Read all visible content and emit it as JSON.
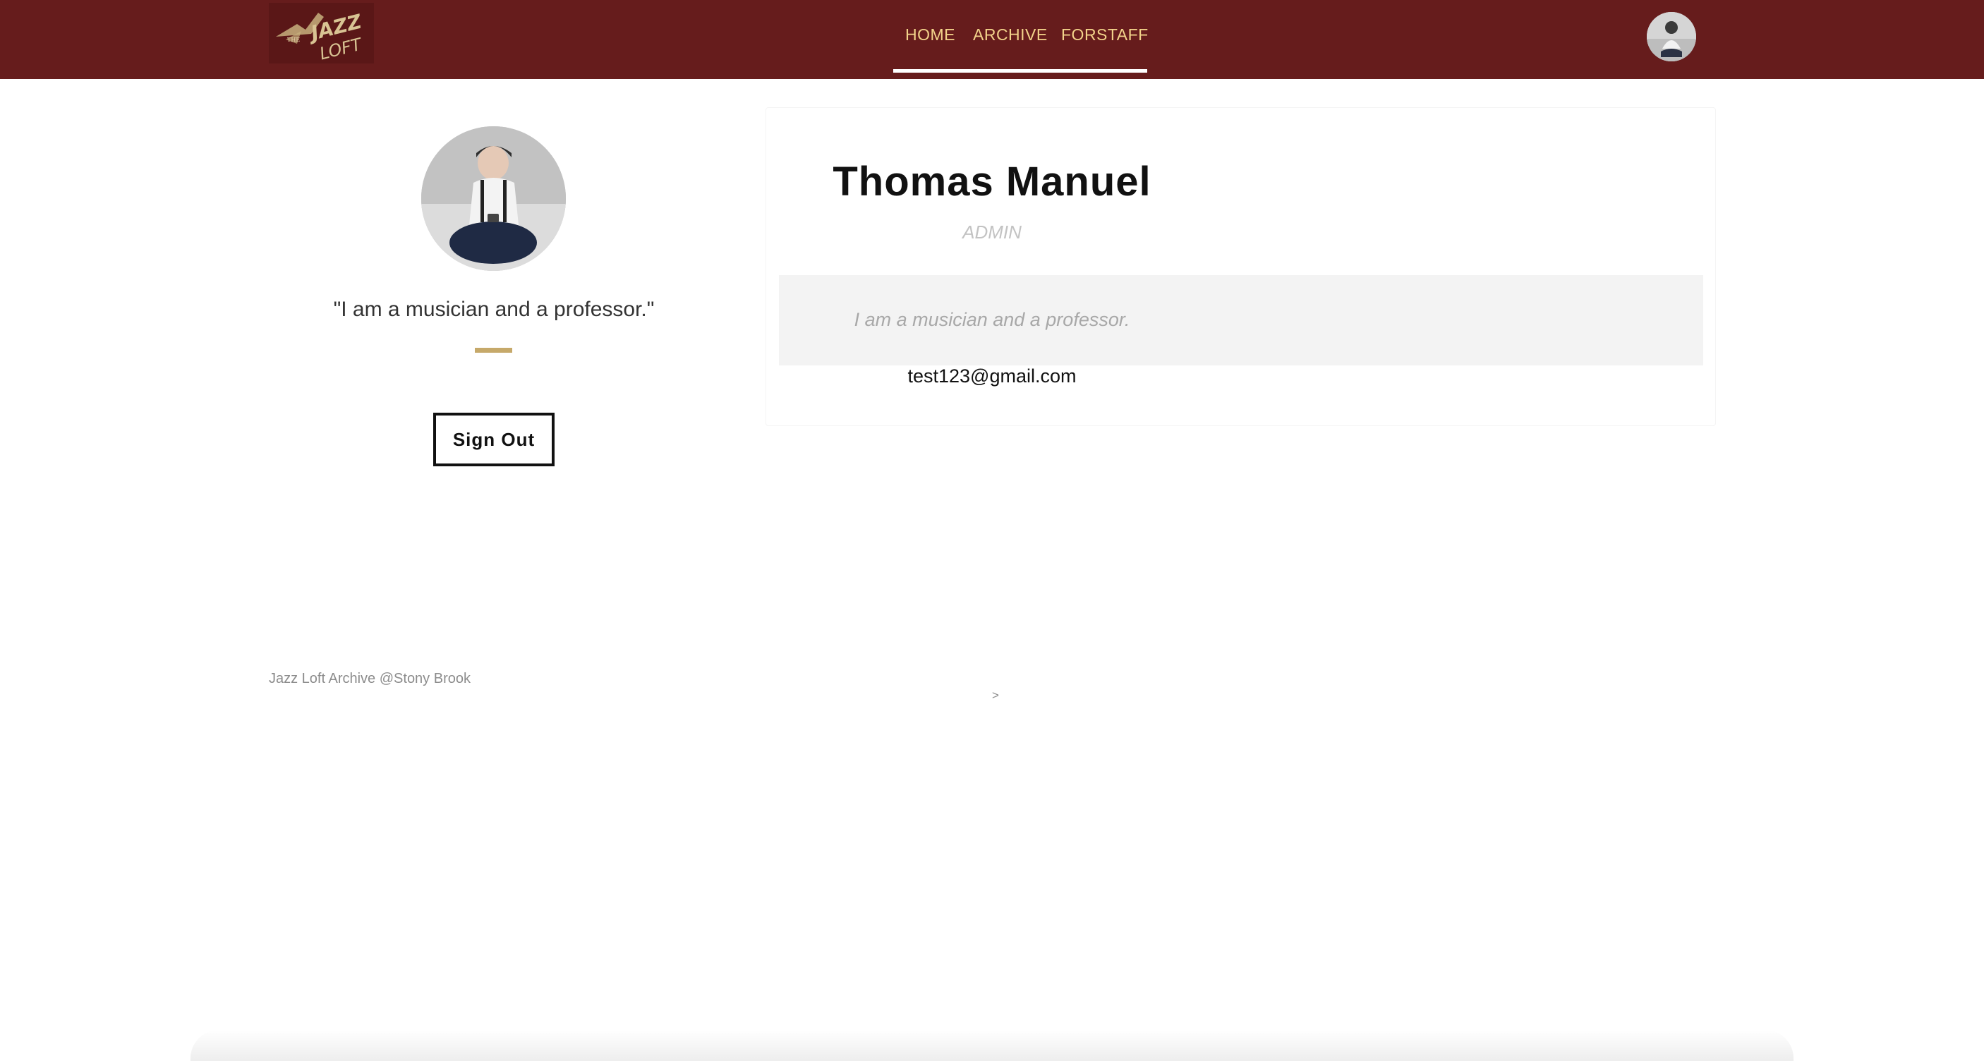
{
  "navbar": {
    "logo_text": "THE JAZZ LOFT",
    "links": [
      "HOME",
      "ARCHIVE",
      "FORSTAFF"
    ],
    "colors": {
      "background": "#661c1c",
      "link": "#f2d38a",
      "underline": "#ffffff"
    }
  },
  "profile": {
    "quote": "\"I am a musician and a professor.\"",
    "sign_out_label": "Sign Out",
    "accent_color": "#c6a96a"
  },
  "card": {
    "name": "Thomas Manuel",
    "role": "ADMIN",
    "bio": "I am a musician and a professor.",
    "email": "test123@gmail.com"
  },
  "footer": {
    "text": "Jazz Loft Archive @Stony Brook",
    "chevron": ">"
  }
}
